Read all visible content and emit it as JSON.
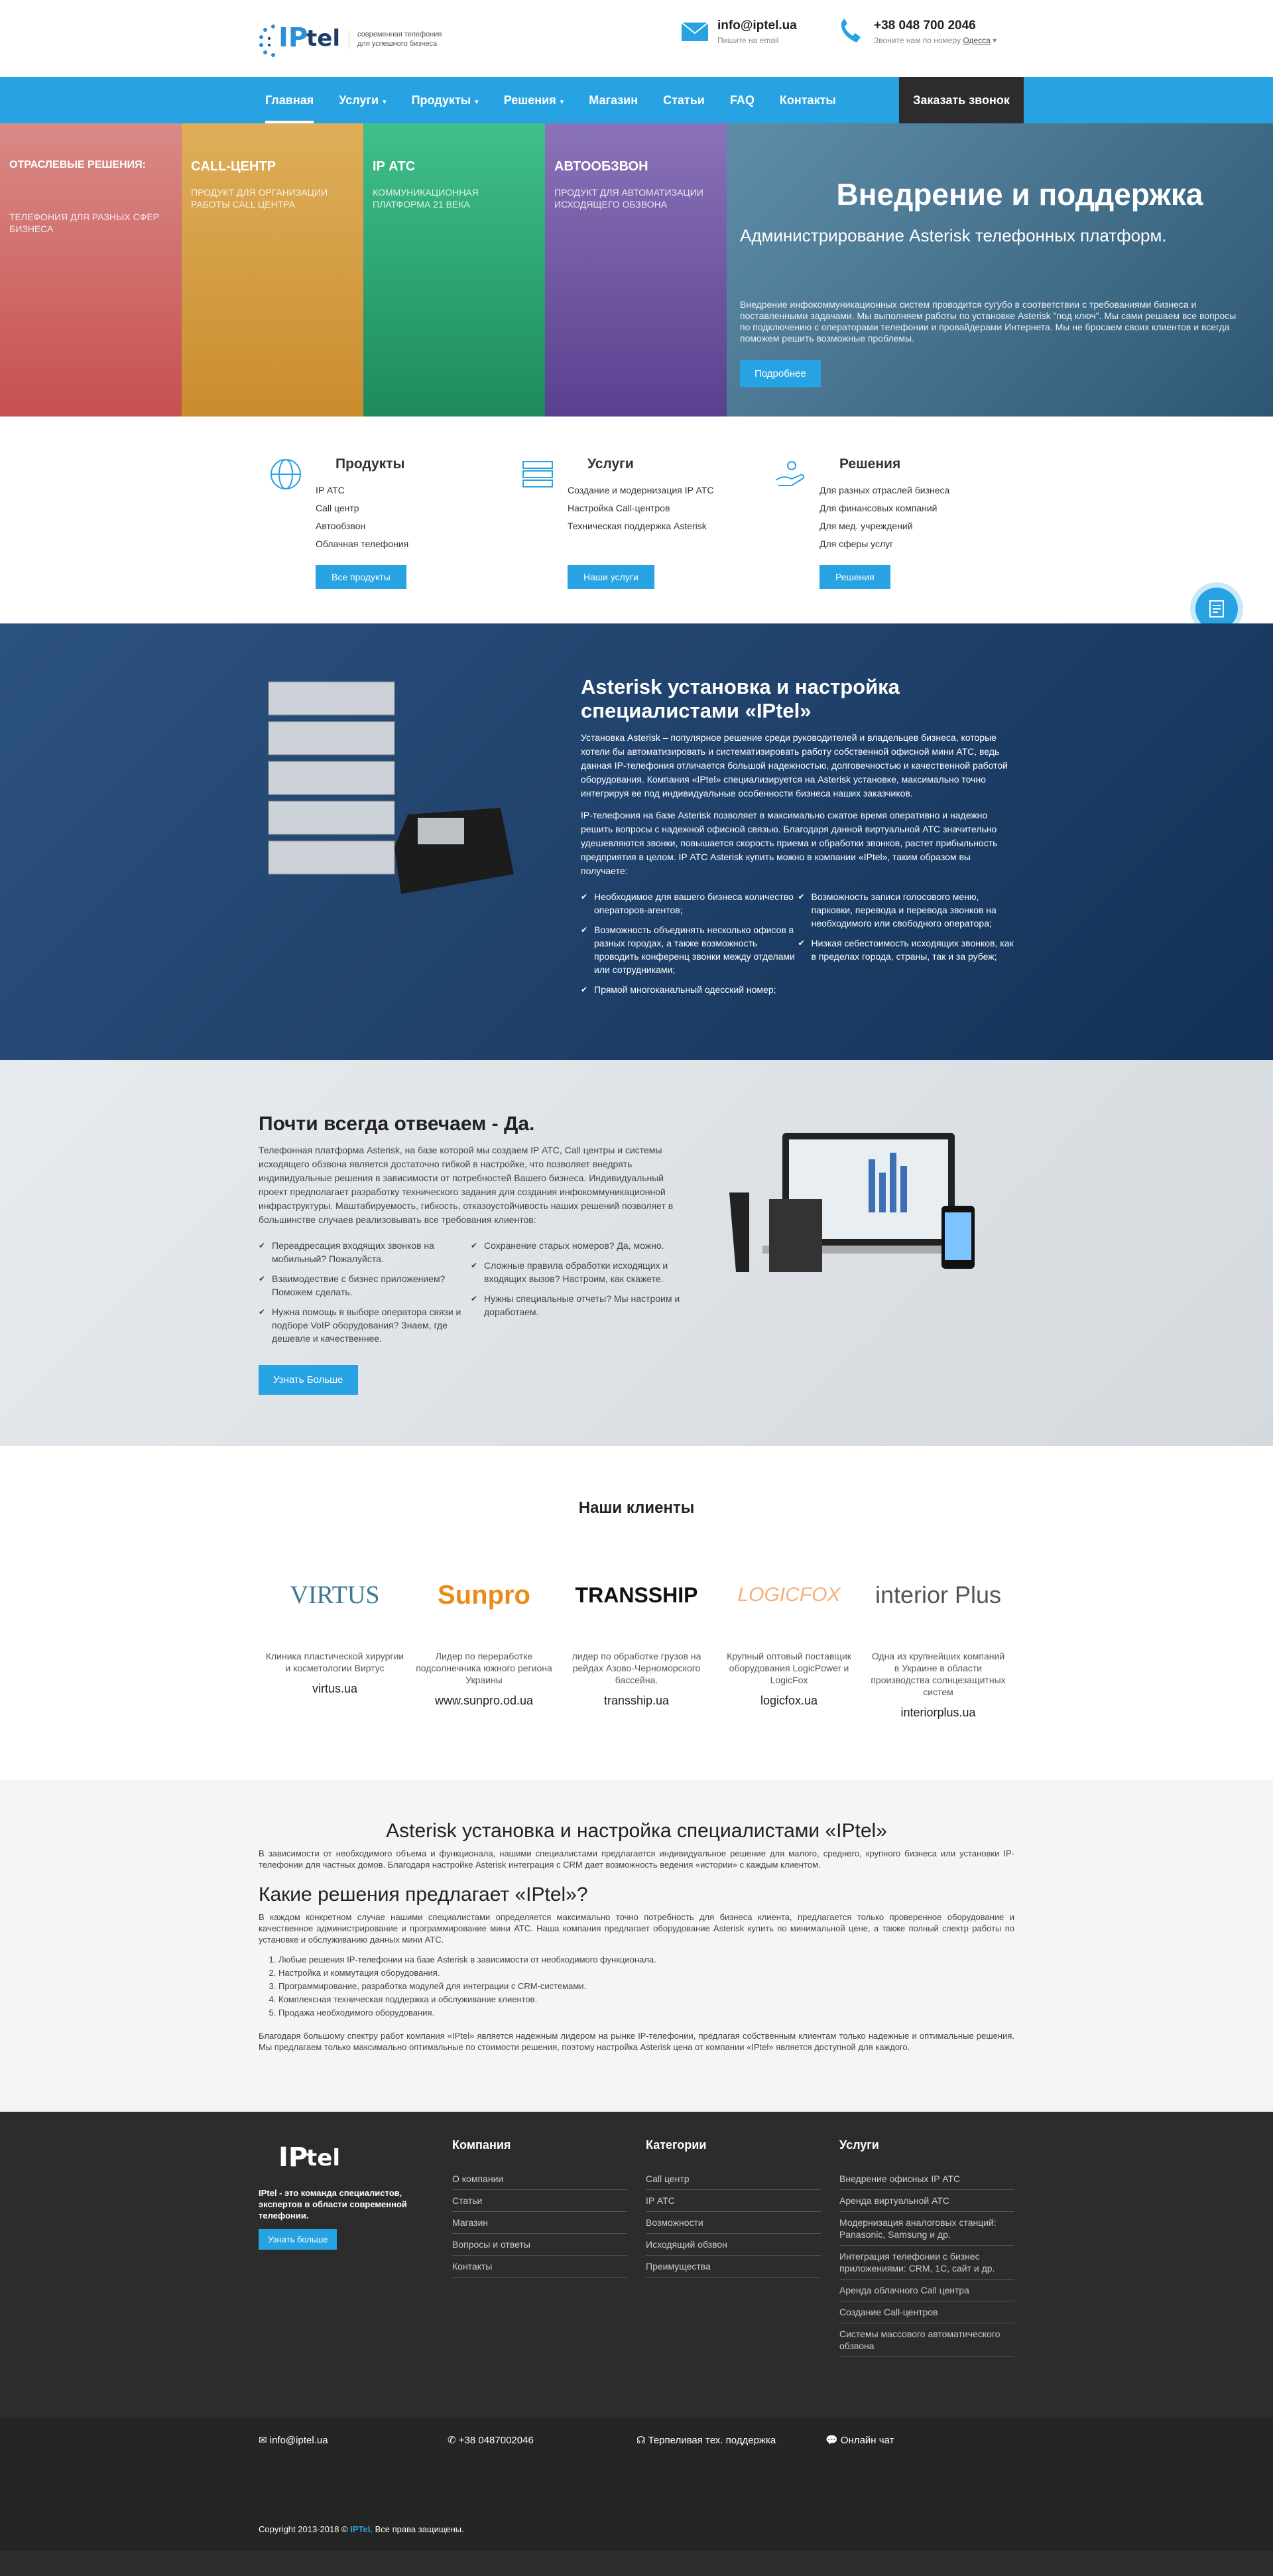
{
  "header": {
    "logo_ip": "IP",
    "logo_tel": "tel",
    "tagline": "современная телефония для успешного бизнеса",
    "email": "info@iptel.ua",
    "email_sub": "Пишите на email",
    "phone": "+38 048 700 2046",
    "phone_sub": "Звоните нам по номеру",
    "city": "Одесса"
  },
  "nav": {
    "items": [
      "Главная",
      "Услуги",
      "Продукты",
      "Решения",
      "Магазин",
      "Статьи",
      "FAQ",
      "Контакты"
    ],
    "call": "Заказать звонок"
  },
  "hero": {
    "cols": [
      {
        "title": "ОТРАСЛЕВЫЕ РЕШЕНИЯ:",
        "text": "ТЕЛЕФОНИЯ ДЛЯ РАЗНЫХ СФЕР БИЗНЕСА"
      },
      {
        "title": "CALL-ЦЕНТР",
        "text": "ПРОДУКТ ДЛЯ ОРГАНИЗАЦИИ РАБОТЫ CALL ЦЕНТРА"
      },
      {
        "title": "IP АТС",
        "text": "КОММУНИКАЦИОННАЯ ПЛАТФОРМА 21 ВЕКА"
      },
      {
        "title": "АВТООБЗВОН",
        "text": "ПРОДУКТ ДЛЯ АВТОМАТИЗАЦИИ ИСХОДЯЩЕГО ОБЗВОНА"
      }
    ],
    "title": "Внедрение и поддержка",
    "subtitle": "Администрирование Asterisk телефонных платформ.",
    "text": "Внедрение инфокоммуникационных систем проводится сугубо в соответствии с требованиями бизнеса и поставленными задачами. Мы выполняем работы по установке Asterisk \"под ключ\". Мы сами решаем все вопросы по подключению с операторами телефонии и провайдерами Интернета. Мы не бросаем своих клиентов и всегда поможем решить возможные проблемы.",
    "button": "Подробнее"
  },
  "features": [
    {
      "title": "Продукты",
      "items": [
        "IP АТС",
        "Call центр",
        "Автообзвон",
        "Облачная телефония"
      ],
      "button": "Все продукты"
    },
    {
      "title": "Услуги",
      "items": [
        "Создание и модернизация IP АТС",
        "Настройка Call-центров",
        "Техническая поддержка Asterisk"
      ],
      "button": "Наши услуги"
    },
    {
      "title": "Решения",
      "items": [
        "Для разных отраслей бизнеса",
        "Для финансовых компаний",
        "Для мед. учреждений",
        "Для сферы услуг"
      ],
      "button": "Решения"
    }
  ],
  "asterisk": {
    "title": "Asterisk установка и настройка специалистами «IPtel»",
    "p1": "Установка Asterisk – популярное решение среди руководителей и владельцев бизнеса, которые хотели бы автоматизировать и систематизировать работу собственной офисной мини АТС, ведь данная IP-телефония отличается большой надежностью, долговечностью и качественной работой оборудования. Компания «IPtel» специализируется на Asterisk установке, максимально точно интегрируя ее под индивидуальные особенности бизнеса наших заказчиков.",
    "p2": "IP-телефония на базе Asterisk позволяет в максимально сжатое время оперативно и надежно решить вопросы с надежной офисной связью. Благодаря данной виртуальной АТС значительно удешевляются звонки, повышается скорость приема и обработки звонков, растет прибыльность предприятия в целом. IP АТС Asterisk купить можно в компании «IPtel», таким образом вы получаете:",
    "left": [
      "Необходимое для вашего бизнеса количество операторов-агентов;",
      "Возможность объединять несколько офисов в разных городах, а также возможность проводить конференц звонки между отделами или сотрудниками;",
      "Прямой многоканальный одесский номер;"
    ],
    "right": [
      "Возможность записи голосового меню, парковки, перевода и перевода звонков на необходимого или свободного оператора;",
      "Низкая себестоимость исходящих звонков, как в пределах города, страны, так и за рубеж;"
    ]
  },
  "answer": {
    "title": "Почти всегда отвечаем - Да.",
    "text": "Телефонная платформа Asterisk, на базе которой мы создаем IP АТС, Call центры и системы исходящего обзвона является достаточно гибкой в настройке, что позволяет внедрять индивидуальные решения в зависимости от потребностей Вашего бизнеса. Индивидуальный проект предполагает разработку технического задания для создания инфокоммуникационной инфраструктуры. Маштабируемость, гибкость, отказоустойчивость наших решений позволяет в большинстве случаев реализовывать все требования клиентов:",
    "left": [
      "Переадресация входящих звонков на мобильный? Пожалуйста.",
      "Взаимодествие с бизнес приложением? Поможем сделать.",
      "Нужна помощь в выборе оператора связи и подборе VoIP оборудования? Знаем, где дешевле и качественнее."
    ],
    "right": [
      "Сохранение старых номеров? Да, можно.",
      "Сложные правила обработки исходящих и входящих вызов? Настроим, как скажете.",
      "Нужны специальные отчеты? Мы настроим и доработаем."
    ],
    "button": "Узнать Больше"
  },
  "clients": {
    "title": "Наши клиенты",
    "items": [
      {
        "logo": "VIRTUS",
        "desc": "Клиника пластической хирургии и косметологии Виртус",
        "url": "virtus.ua"
      },
      {
        "logo": "Sunpro",
        "desc": "Лидер по переработке подсолнечника южного региона Украины",
        "url": "www.sunpro.od.ua"
      },
      {
        "logo": "TRANSSHIP",
        "desc": "лидер по обработке грузов на рейдах Азово-Черноморского бассейна.",
        "url": "transship.ua"
      },
      {
        "logo": "LOGICFOX",
        "desc": "Крупный оптовый поставщик оборудования LogicPower и LogicFox",
        "url": "logicfox.ua"
      },
      {
        "logo": "interior Plus",
        "desc": "Одна из крупнейших компаний в Украине в области производства солнцезащитных систем",
        "url": "interiorplus.ua"
      }
    ]
  },
  "seo": {
    "title": "Asterisk установка и настройка специалистами «IPtel»",
    "p1": "В зависимости от необходимого объема и функционала, нашими специалистами предлагается индивидуальное решение для малого, среднего, крупного бизнеса или установки IP-телефонии для частных домов. Благодаря настройке Asterisk интеграция с CRM дает возможность ведения «истории» с каждым клиентом.",
    "subtitle": "Какие решения предлагает «IPtel»?",
    "p2": "В каждом конкретном случае нашими специалистами определяется максимально точно потребность для бизнеса клиента, предлагается только проверенное оборудование и качественное администрирование и программирование мини АТС. Наша компания предлагает оборудование Asterisk купить по минимальной цене, а также полный спектр работы по установке и обслуживанию данных мини АТС.",
    "list": [
      "Любые решения IP-телефонии на базе Asterisk в зависимости от необходимого функционала.",
      "Настройка и коммутация оборудования.",
      "Программирование, разработка модулей для интеграции с CRM-системами.",
      "Комплексная техническая поддержка и обслуживание клиентов.",
      "Продажа необходимого оборудования."
    ],
    "p3": "Благодаря большому спектру работ компания «IPtel» является надежным лидером на рынке IP-телефонии, предлагая собственным клиентам только надежные и оптимальные решения. Мы предлагаем только максимально оптимальные по стоимости решения, поэтому настройка Asterisk цена от компании «IPtel» является доступной для каждого."
  },
  "footer": {
    "about": "IPtel - это команда специалистов, экспертов в области современной телефонии.",
    "button": "Узнать больше",
    "company": {
      "title": "Компания",
      "links": [
        "О компании",
        "Статьи",
        "Магазин",
        "Вопросы и ответы",
        "Контакты"
      ]
    },
    "categories": {
      "title": "Категории",
      "links": [
        "Call центр",
        "IP АТС",
        "Возможности",
        "Исходящий обзвон",
        "Преимущества"
      ]
    },
    "services": {
      "title": "Услуги",
      "links": [
        "Внедрение офисных IP АТС",
        "Аренда виртуальной АТС",
        "Модернизация аналоговых станций: Panasonic, Samsung и др.",
        "Интеграция телефонии с бизнес приложениями: CRM, 1С, сайт и др.",
        "Аренда облачного Call центра",
        "Создание Call-центров",
        "Системы массового автоматического обзвона"
      ]
    },
    "email": "info@iptel.ua",
    "phone": "+38 0487002046",
    "support": "Терпеливая тех. поддержка",
    "chat": "Онлайн чат",
    "copy_pre": "Copyright 2013-2018 ©",
    "copy_brand": "IPTel",
    "copy_post": ". Все права защищены."
  }
}
